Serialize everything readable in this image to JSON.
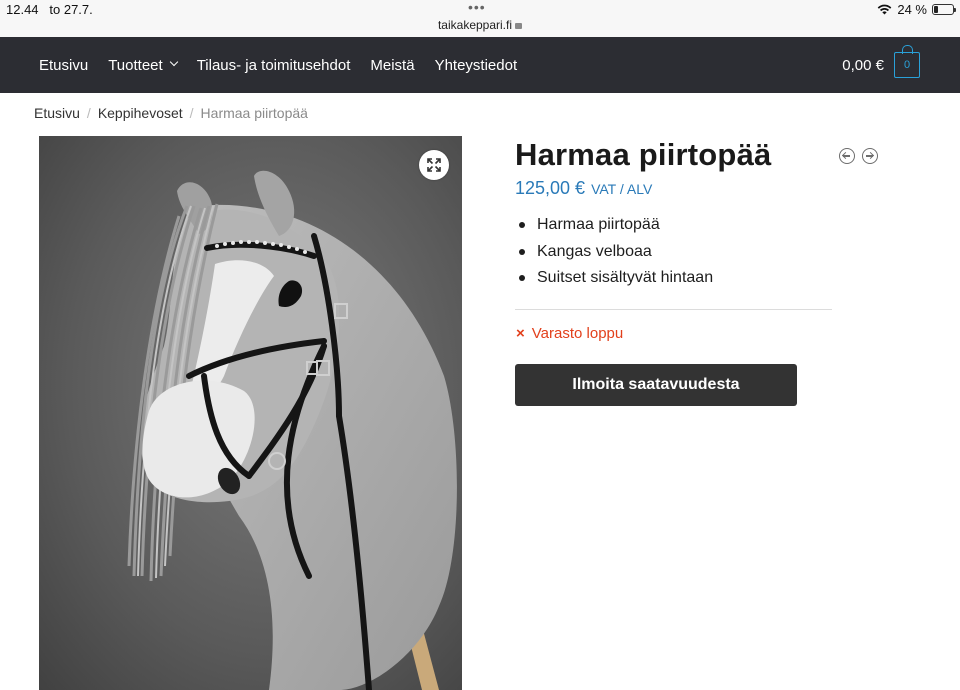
{
  "status_bar": {
    "time": "12.44",
    "date": "to 27.7.",
    "url": "taikakeppari.fi",
    "battery": "24 %",
    "battery_level": 0.24
  },
  "nav": {
    "items": [
      "Etusivu",
      "Tuotteet",
      "Tilaus- ja toimitusehdot",
      "Meistä",
      "Yhteystiedot"
    ],
    "cart_total": "0,00 €",
    "cart_count": "0"
  },
  "breadcrumb": {
    "items": [
      "Etusivu",
      "Keppihevoset"
    ],
    "current": "Harmaa piirtopää",
    "separator": "/"
  },
  "product": {
    "title": "Harmaa piirtopää",
    "price": "125,00 €",
    "vat_label": "VAT / ALV",
    "features": [
      "Harmaa piirtopää",
      "Kangas velboaa",
      "Suitset sisältyvät hintaan"
    ],
    "stock_icon": "×",
    "stock_status": "Varasto loppu",
    "notify_button": "Ilmoita saatavuudesta"
  },
  "colors": {
    "nav_bg": "#2c2d33",
    "price": "#2a7ab8",
    "stock": "#e2401c",
    "button": "#333333",
    "cart_accent": "#2aa1d9"
  }
}
